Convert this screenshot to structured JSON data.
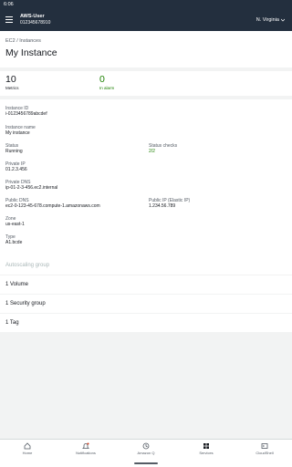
{
  "status_bar": {
    "time": "6:06"
  },
  "topbar": {
    "user_name": "AWS-User",
    "account_id": "012345678910",
    "region": "N. Virginia"
  },
  "header": {
    "breadcrumb": "EC2 / Instances",
    "title": "My Instance"
  },
  "metrics": [
    {
      "value": "10",
      "label": "Metrics"
    },
    {
      "value": "0",
      "label": "In alarm"
    }
  ],
  "details": {
    "instance_id": {
      "label": "Instance ID",
      "value": "i-0123456789abcdef"
    },
    "instance_name": {
      "label": "Instance name",
      "value": "My instance"
    },
    "status": {
      "label": "Status",
      "value": "Running"
    },
    "status_checks": {
      "label": "Status checks",
      "value": "2/2"
    },
    "private_ip": {
      "label": "Private IP",
      "value": "01.2.3.456"
    },
    "private_dns": {
      "label": "Private DNS",
      "value": "ip-01-2-3-456.ec2.internal"
    },
    "public_dns": {
      "label": "Public DNS",
      "value": "ec2-0-123-45-678.compute-1.amazonaws.com"
    },
    "public_ip": {
      "label": "Public IP (Elastic IP)",
      "value": "1.234.56.789"
    },
    "zone": {
      "label": "Zone",
      "value": "us-east-1"
    },
    "type": {
      "label": "Type",
      "value": "A1.bcde"
    }
  },
  "sections": {
    "autoscaling": "Autoscaling group",
    "volume": "1 Volume",
    "security_group": "1 Security group",
    "tag": "1 Tag"
  },
  "bottom_nav": {
    "home": "Home",
    "notifications": "Notifications",
    "amazon_q": "Amazon Q",
    "services": "Services",
    "cloudshell": "CloudShell"
  },
  "colors": {
    "topbar_bg": "#232f3e",
    "success": "#1d8102",
    "disabled": "#aab7b8"
  }
}
